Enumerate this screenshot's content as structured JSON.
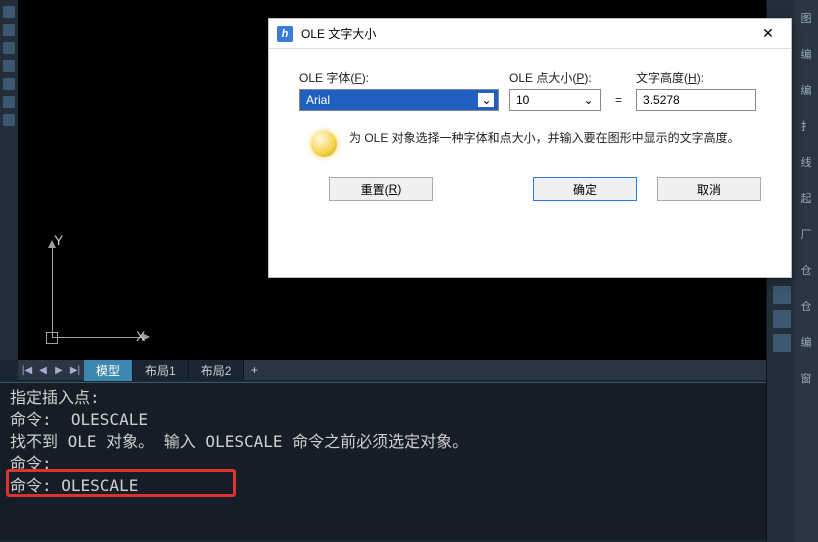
{
  "canvas": {
    "y_label": "Y",
    "x_label": "X"
  },
  "tabs": {
    "items": [
      "模型",
      "布局1",
      "布局2"
    ],
    "add": "+"
  },
  "command": {
    "lines": [
      "指定插入点:",
      "命令:  OLESCALE",
      "找不到 OLE 对象。 输入 OLESCALE 命令之前必须选定对象。",
      "命令:",
      "命令: OLESCALE"
    ]
  },
  "dialog": {
    "title": "OLE 文字大小",
    "font_label_pre": "OLE 字体(",
    "font_label_key": "F",
    "font_label_post": "):",
    "font_value": "Arial",
    "size_label_pre": "OLE 点大小(",
    "size_label_key": "P",
    "size_label_post": "):",
    "size_value": "10",
    "height_label_pre": "文字高度(",
    "height_label_key": "H",
    "height_label_post": "):",
    "height_value": "3.5278",
    "equals": "=",
    "tip": "为 OLE 对象选择一种字体和点大小，并输入要在图形中显示的文字高度。",
    "reset_pre": "重置(",
    "reset_key": "R",
    "reset_post": ")",
    "ok": "确定",
    "cancel": "取消"
  },
  "right": {
    "t1": "图",
    "t2": "编",
    "t3": "编",
    "t4": "扌",
    "t5": "线",
    "t6": "起",
    "t7": "厂",
    "t8": "仓",
    "t9": "仓",
    "t10": "编",
    "t11": "窗"
  }
}
